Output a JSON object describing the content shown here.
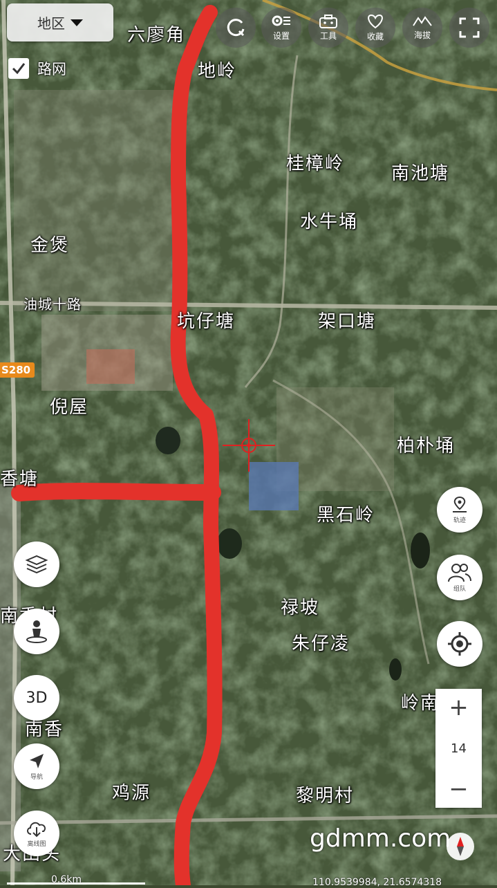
{
  "region_button": {
    "label": "地区"
  },
  "road_network": {
    "label": "路网",
    "checked": true
  },
  "top_toolbar": [
    {
      "id": "refresh",
      "label": "",
      "icon": "refresh-icon"
    },
    {
      "id": "settings",
      "label": "设置",
      "icon": "gear-icon"
    },
    {
      "id": "tools",
      "label": "工具",
      "icon": "toolbox-icon"
    },
    {
      "id": "favorites",
      "label": "收藏",
      "icon": "heart-icon"
    },
    {
      "id": "altitude",
      "label": "海拔",
      "icon": "mountain-icon"
    },
    {
      "id": "fullscreen",
      "label": "",
      "icon": "fullscreen-icon"
    }
  ],
  "map_labels": {
    "liu_liao_jiao": "六廖角",
    "di_ling": "地岭",
    "gui_zhang_ling": "桂樟岭",
    "nan_chi_tang": "南池塘",
    "shui_niu_yong": "水牛埇",
    "jin_bao": "金煲",
    "you_cheng_shi_lu": "油城十路",
    "kang_zai_tang": "坑仔塘",
    "jia_kou_tang": "架口塘",
    "ni_wu": "倪屋",
    "bai_pu_yong": "柏朴埇",
    "xiang_tang": "香塘",
    "hei_shi_ling": "黑石岭",
    "nan_xiang_cun": "南香村",
    "lu_po": "禄坡",
    "zhu_zai_ling": "朱仔凌",
    "ling_nan": "岭南",
    "nan_xiang": "南香",
    "ji_yuan": "鸡源",
    "li_ming_cun": "黎明村",
    "da_tian_tou": "大田头"
  },
  "road_shield": "S280",
  "side_left_buttons": [
    {
      "id": "layers",
      "label": "",
      "icon": "layers-icon"
    },
    {
      "id": "streetview",
      "label": "",
      "icon": "person-pin-icon"
    },
    {
      "id": "threed",
      "label": "3D",
      "icon": ""
    },
    {
      "id": "navigate",
      "label": "导航",
      "icon": "navigation-arrow-icon"
    },
    {
      "id": "offline",
      "label": "离线图",
      "icon": "cloud-download-icon"
    }
  ],
  "side_right_buttons": [
    {
      "id": "track",
      "label": "轨迹",
      "icon": "track-pin-icon"
    },
    {
      "id": "team",
      "label": "组队",
      "icon": "team-icon"
    },
    {
      "id": "locate",
      "label": "",
      "icon": "locate-icon"
    }
  ],
  "zoom": {
    "plus": "+",
    "level": "14",
    "minus": "−"
  },
  "watermark": "gdmm.com",
  "scale_text": "0.6km",
  "coordinates_text": "110.9539984, 21.6574318",
  "colors": {
    "route": "#e3322b",
    "crosshair": "#e02020",
    "accent_orange": "#e88a1c"
  }
}
